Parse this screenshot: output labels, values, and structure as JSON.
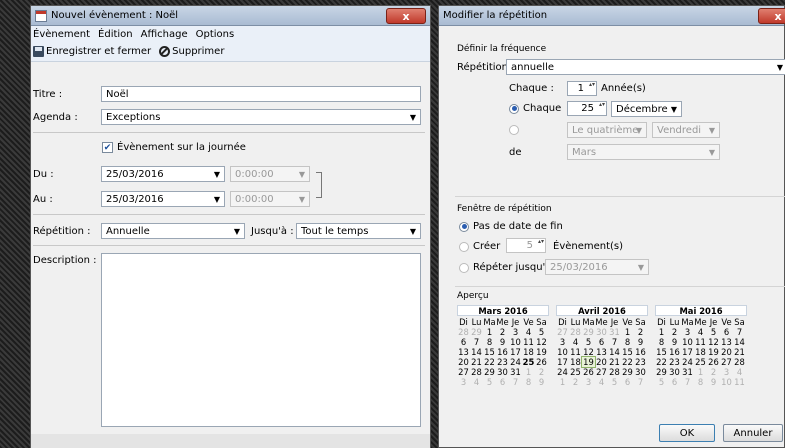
{
  "left": {
    "title": "Nouvel évènement : Noël",
    "close": "x",
    "menu": [
      "Évènement",
      "Édition",
      "Affichage",
      "Options"
    ],
    "toolbar": {
      "save": "Enregistrer et fermer",
      "delete": "Supprimer"
    },
    "title_label": "Titre :",
    "title_value": "Noël",
    "agenda_label": "Agenda :",
    "agenda_value": "Exceptions",
    "allday_label": "Évènement sur la journée",
    "du_label": "Du :",
    "du_date": "25/03/2016",
    "du_time": "0:00:00",
    "au_label": "Au :",
    "au_date": "25/03/2016",
    "au_time": "0:00:00",
    "repeat_label": "Répétition :",
    "repeat_value": "Annuelle",
    "until_label": "Jusqu'à :",
    "until_value": "Tout le temps",
    "desc_label": "Description :"
  },
  "right": {
    "title": "Modifier la répétition",
    "close": "x",
    "freq_group": "Définir la fréquence",
    "repeat_label": "Répétition",
    "repeat_value": "annuelle",
    "every_label": "Chaque :",
    "every_value": "1",
    "years_label": "Année(s)",
    "chaque_label": "Chaque",
    "day_value": "25",
    "month_value": "Décembre",
    "nth_value": "Le quatrième",
    "weekday_value": "Vendredi",
    "de_label": "de",
    "de_month": "Mars",
    "window_group": "Fenêtre de répétition",
    "no_end": "Pas de date de fin",
    "create_label": "Créer",
    "create_value": "5",
    "events_label": "Évènement(s)",
    "until_label": "Répéter jusqu'à",
    "until_value": "25/03/2016",
    "preview_group": "Aperçu",
    "ok": "OK",
    "cancel": "Annuler",
    "days_header": [
      "Di",
      "Lu",
      "Ma",
      "Me",
      "Je",
      "Ve",
      "Sa"
    ],
    "calendars": [
      {
        "name": "Mars 2016",
        "days": [
          "28",
          "29",
          "1",
          "2",
          "3",
          "4",
          "5",
          "6",
          "7",
          "8",
          "9",
          "10",
          "11",
          "12",
          "13",
          "14",
          "15",
          "16",
          "17",
          "18",
          "19",
          "20",
          "21",
          "22",
          "23",
          "24",
          "25",
          "26",
          "27",
          "28",
          "29",
          "30",
          "31",
          "1",
          "2",
          "3",
          "4",
          "5",
          "6",
          "7",
          "8",
          "9"
        ]
      },
      {
        "name": "Avril 2016",
        "days": [
          "27",
          "28",
          "29",
          "30",
          "31",
          "1",
          "2",
          "3",
          "4",
          "5",
          "6",
          "7",
          "8",
          "9",
          "10",
          "11",
          "12",
          "13",
          "14",
          "15",
          "16",
          "17",
          "18",
          "19",
          "20",
          "21",
          "22",
          "23",
          "24",
          "25",
          "26",
          "27",
          "28",
          "29",
          "30",
          "1",
          "2",
          "3",
          "4",
          "5",
          "6",
          "7"
        ]
      },
      {
        "name": "Mai 2016",
        "days": [
          "1",
          "2",
          "3",
          "4",
          "5",
          "6",
          "7",
          "8",
          "9",
          "10",
          "11",
          "12",
          "13",
          "14",
          "15",
          "16",
          "17",
          "18",
          "19",
          "20",
          "21",
          "22",
          "23",
          "24",
          "25",
          "26",
          "27",
          "28",
          "29",
          "30",
          "31",
          "1",
          "2",
          "3",
          "4",
          "5",
          "6",
          "7",
          "8",
          "9",
          "10",
          "11"
        ]
      }
    ]
  }
}
